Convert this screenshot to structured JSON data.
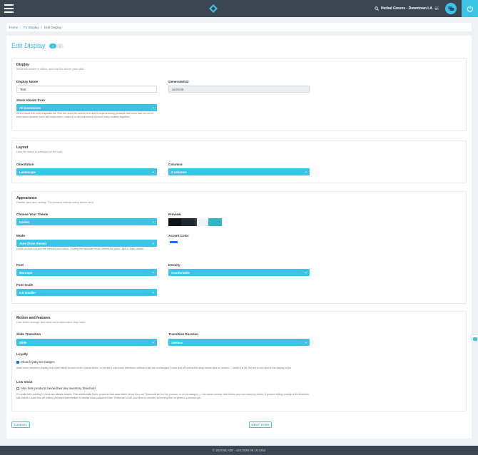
{
  "header": {
    "store_name": "Herbal Greens - Downtown LA"
  },
  "breadcrumb": {
    "home": "Home",
    "tv_display": "TV Display",
    "current": "Edit Display"
  },
  "page": {
    "title": "Edit Display",
    "steps": [
      "1",
      "2"
    ]
  },
  "display_section": {
    "title": "Display",
    "subtitle": "What this screen is called, and how it’s device pairs with.",
    "name_label": "Display Name",
    "name_value": "Test",
    "id_label": "Generated ID",
    "id_value": "ae3ms8",
    "stock_label": "Stock shown from",
    "stock_value": "All inventories",
    "stock_hint": "Which stock this screen speaks for. Pick the room the screen is in and it stops showing products that room has run out of, even when another room still holds them. Leave it on all inventories to count every location together."
  },
  "layout_section": {
    "title": "Layout",
    "subtitle": "How the board is arranged on the wall.",
    "orientation_label": "Orientation",
    "orientation_value": "Landscape",
    "columns_label": "Columns",
    "columns_value": "2 columns"
  },
  "appearance_section": {
    "title": "Appearance",
    "subtitle": "Palette, type and density. The preview reflects every theme here.",
    "theme_label": "Choose Your Theme",
    "theme_value": "Harbor",
    "preview_label": "Preview",
    "preview_colors": [
      "#0d1418",
      "#1c2a30",
      "#2e3e44",
      "#eef3f5",
      "#30b6c2"
    ],
    "mode_label": "Mode",
    "mode_value": "Auto (from theme)",
    "mode_hint": "Leave on Auto to keep the theme’s own colors. Forcing the opposite mode returns the plain Light or Dark palette.",
    "accent_label": "Accent Color",
    "accent_color": "#1a73e8",
    "font_label": "Font",
    "font_value": "Manrope",
    "density_label": "Density",
    "density_value": "Comfortable",
    "scale_label": "Font Scale",
    "scale_value": "0.8 Smaller"
  },
  "motion_section": {
    "title": "Motion and features",
    "subtitle": "How slides change, and what extra information they carry.",
    "transition_label": "Slide Transition",
    "transition_value": "Slide",
    "duration_label": "Transition Duration",
    "duration_value": "1500ms",
    "loyalty_title": "Loyalty",
    "loyalty_checkbox": "Show loyalty tier badges",
    "loyalty_hint": "Adds each member’s loyalty tier to the Wait List and Order Queue slides, in the tier’s own color. Members without a tier are unchanged. Leave this off unless the shop wants tiers on screen — while it is off, the tier is not sent to the display at all.",
    "lowstock_title": "Low stock",
    "lowstock_checkbox": "Also hide products below their low inventory threshold",
    "lowstock_hint": "Products with nothing in stock are always hidden. This additionally hides products that have fallen below the Low Threshold set on the product, or on its category — the same number that drives your low inventory alerts. A product sitting exactly at its threshold still shows. Leave this off unless you want that number to decide what customers see. It was set to tell you when to reorder, so turning this on gives it a second job."
  },
  "actions": {
    "cancel": "CANCEL",
    "next": "NEXT STEP"
  },
  "footer": {
    "text": "© 2024 BLAZE - v25.2026.09.16.1454"
  },
  "colors": {
    "accent": "#3bc4e6",
    "topbar": "#3c4652",
    "title": "#3bb1d6",
    "link": "#2b7fc3"
  }
}
